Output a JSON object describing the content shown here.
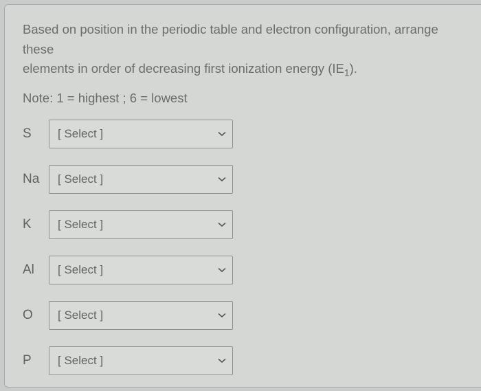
{
  "question": {
    "prompt_line1": "Based on position in the periodic table and electron configuration, arrange these",
    "prompt_line2_prefix": "elements in order of decreasing first ionization energy (IE",
    "prompt_line2_sub": "1",
    "prompt_line2_suffix": ")."
  },
  "note": "Note: 1 = highest ; 6 = lowest",
  "select_placeholder": "[ Select ]",
  "elements": [
    {
      "symbol": "S",
      "value": "[ Select ]"
    },
    {
      "symbol": "Na",
      "value": "[ Select ]"
    },
    {
      "symbol": "K",
      "value": "[ Select ]"
    },
    {
      "symbol": "Al",
      "value": "[ Select ]"
    },
    {
      "symbol": "O",
      "value": "[ Select ]"
    },
    {
      "symbol": "P",
      "value": "[ Select ]"
    }
  ]
}
